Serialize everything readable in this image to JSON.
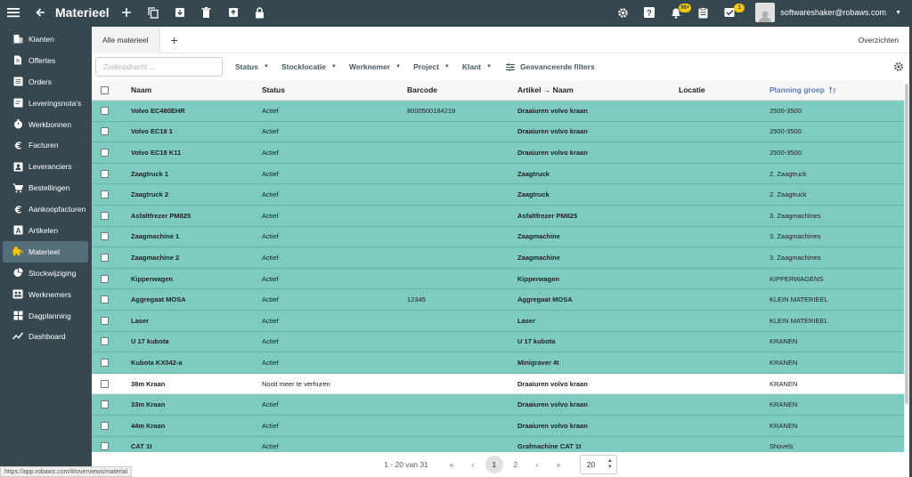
{
  "topbar": {
    "title": "Materieel",
    "notifications_badge": "99+",
    "tasks_badge": "1",
    "user_email": "softwareshaker@robaws.com"
  },
  "sidebar": {
    "items": [
      {
        "label": "Klanten",
        "icon": "building-icon"
      },
      {
        "label": "Offertes",
        "icon": "document-icon"
      },
      {
        "label": "Orders",
        "icon": "list-icon"
      },
      {
        "label": "Leveringsnota's",
        "icon": "delivery-note-icon"
      },
      {
        "label": "Werkbonnen",
        "icon": "work-order-icon"
      },
      {
        "label": "Facturen",
        "icon": "euro-icon"
      },
      {
        "label": "Leveranciers",
        "icon": "supplier-icon"
      },
      {
        "label": "Bestellingen",
        "icon": "cart-icon"
      },
      {
        "label": "Aankoopfacturen",
        "icon": "euro-icon"
      },
      {
        "label": "Artikelen",
        "icon": "article-icon"
      },
      {
        "label": "Materieel",
        "icon": "equipment-icon"
      },
      {
        "label": "Stockwijziging",
        "icon": "pie-chart-icon"
      },
      {
        "label": "Werknemers",
        "icon": "employees-icon"
      },
      {
        "label": "Dagplanning",
        "icon": "planning-icon"
      },
      {
        "label": "Dashboard",
        "icon": "trend-chart-icon"
      }
    ],
    "active": "Materieel"
  },
  "tabs": {
    "active_tab": "Alle materieel",
    "right_link": "Overzichten"
  },
  "filters": {
    "search_placeholder": "Zoekopdracht ...",
    "status": "Status",
    "stocklocatie": "Stocklocatie",
    "werknemer": "Werknemer",
    "project": "Project",
    "klant": "Klant",
    "advanced": "Geavanceerde filters"
  },
  "table": {
    "columns": {
      "naam": "Naam",
      "status": "Status",
      "barcode": "Barcode",
      "artikel": "Artikel → Naam",
      "locatie": "Locatie",
      "groep": "Planning groep"
    },
    "rows": [
      {
        "naam": "Volvo EC480EHR",
        "status": "Actief",
        "barcode": "8000500184219",
        "artikel": "Draaiuren volvo kraan",
        "locatie": "",
        "groep": "2500-3500",
        "highlight": true
      },
      {
        "naam": "Volvo EC18 1",
        "status": "Actief",
        "barcode": "",
        "artikel": "Draaiuren volvo kraan",
        "locatie": "",
        "groep": "2500-3500",
        "highlight": true
      },
      {
        "naam": "Volvo EC18 K11",
        "status": "Actief",
        "barcode": "",
        "artikel": "Draaiuren volvo kraan",
        "locatie": "",
        "groep": "2500-3500",
        "highlight": true
      },
      {
        "naam": "Zaagtruck 1",
        "status": "Actief",
        "barcode": "",
        "artikel": "Zaagtruck",
        "locatie": "",
        "groep": "2. Zaagtruck",
        "highlight": true
      },
      {
        "naam": "Zaagtruck 2",
        "status": "Actief",
        "barcode": "",
        "artikel": "Zaagtruck",
        "locatie": "",
        "groep": "2. Zaagtruck",
        "highlight": true
      },
      {
        "naam": "Asfaltfrezer PM825",
        "status": "Actief",
        "barcode": "",
        "artikel": "Asfaltfrezer PM825",
        "locatie": "",
        "groep": "3. Zaagmachines",
        "highlight": true
      },
      {
        "naam": "Zaagmachine 1",
        "status": "Actief",
        "barcode": "",
        "artikel": "Zaagmachine",
        "locatie": "",
        "groep": "3. Zaagmachines",
        "highlight": true
      },
      {
        "naam": "Zaagmachine 2",
        "status": "Actief",
        "barcode": "",
        "artikel": "Zaagmachine",
        "locatie": "",
        "groep": "3. Zaagmachines",
        "highlight": true
      },
      {
        "naam": "Kipperwagen",
        "status": "Actief",
        "barcode": "",
        "artikel": "Kipperwagen",
        "locatie": "",
        "groep": "KIPPERWAGENS",
        "highlight": true
      },
      {
        "naam": "Aggregaat MOSA",
        "status": "Actief",
        "barcode": "12345",
        "artikel": "Aggregaat MOSA",
        "locatie": "",
        "groep": "KLEIN MATERIEEL",
        "highlight": true
      },
      {
        "naam": "Laser",
        "status": "Actief",
        "barcode": "",
        "artikel": "Laser",
        "locatie": "",
        "groep": "KLEIN MATERIEEL",
        "highlight": true
      },
      {
        "naam": "U 17 kubota",
        "status": "Actief",
        "barcode": "",
        "artikel": "U 17 kubota",
        "locatie": "",
        "groep": "KRANEN",
        "highlight": true
      },
      {
        "naam": "Kubota KX042-a",
        "status": "Actief",
        "barcode": "",
        "artikel": "Minigraver 4t",
        "locatie": "",
        "groep": "KRANEN",
        "highlight": true
      },
      {
        "naam": "38m Kraan",
        "status": "Nooit meer te verhuren",
        "barcode": "",
        "artikel": "Draaiuren volvo kraan",
        "locatie": "",
        "groep": "KRANEN",
        "highlight": false
      },
      {
        "naam": "33m Kraan",
        "status": "Actief",
        "barcode": "",
        "artikel": "Draaiuren volvo kraan",
        "locatie": "",
        "groep": "KRANEN",
        "highlight": true
      },
      {
        "naam": "44m Kraan",
        "status": "Actief",
        "barcode": "",
        "artikel": "Draaiuren volvo kraan",
        "locatie": "",
        "groep": "KRANEN",
        "highlight": true
      },
      {
        "naam": "CAT 1t",
        "status": "Actief",
        "barcode": "",
        "artikel": "Grafmachine CAT 1t",
        "locatie": "",
        "groep": "Shovels",
        "highlight": true
      }
    ]
  },
  "pagination": {
    "range": "1 - 20 van 31",
    "pages": [
      "1",
      "2"
    ],
    "current": "1",
    "page_size": "20"
  },
  "statusbar_url": "https://app.robaws.com/#/overviews/material",
  "colors": {
    "highlight_row": "#7ecbc2",
    "sidebar_bg": "#37474f",
    "badge": "#f9c700"
  }
}
